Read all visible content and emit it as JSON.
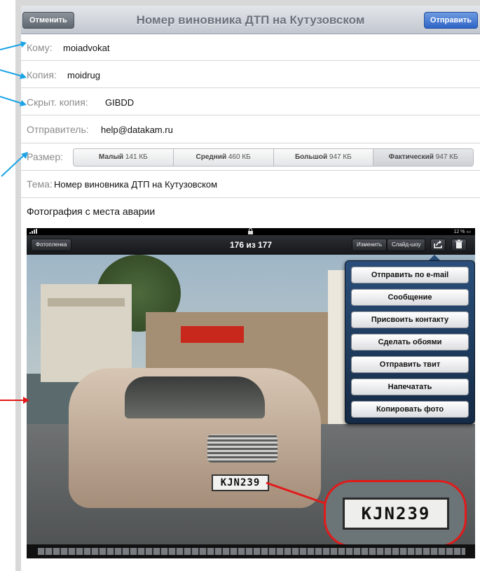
{
  "nav": {
    "cancel_label": "Отменить",
    "title": "Номер виновника ДТП на Кутузовском",
    "send_label": "Отправить"
  },
  "fields": {
    "to_label": "Кому:",
    "to_value": "moiadvokat",
    "cc_label": "Копия:",
    "cc_value": "moidrug",
    "bcc_label": "Скрыт. копия:",
    "bcc_value": "GIBDD",
    "from_label": "Отправитель:",
    "from_value": "help@datakam.ru",
    "size_label": "Размер:",
    "subject_label": "Тема:",
    "subject_value": "Номер виновника ДТП на Кутузовском"
  },
  "size_options": [
    {
      "name": "Малый",
      "size": "141 КБ"
    },
    {
      "name": "Средний",
      "size": "460 КБ"
    },
    {
      "name": "Большой",
      "size": "947 КБ"
    },
    {
      "name": "Фактический",
      "size": "947 КБ"
    }
  ],
  "body_text": "Фотография с места аварии",
  "photo": {
    "battery": "12 %",
    "back_label": "Фотопленка",
    "counter": "176 из 177",
    "edit_label": "Изменить",
    "slideshow_label": "Слайд-шоу",
    "plate_text": "KJN239",
    "zoom_plate_text": "KJN239",
    "share_menu": [
      "Отправить по e-mail",
      "Сообщение",
      "Присвоить контакту",
      "Сделать обоями",
      "Отправить твит",
      "Напечатать",
      "Копировать фото"
    ]
  },
  "colors": {
    "callout_blue": "#1aa3e6",
    "callout_red": "#e21a1a",
    "send_button": "#2f64c6"
  }
}
